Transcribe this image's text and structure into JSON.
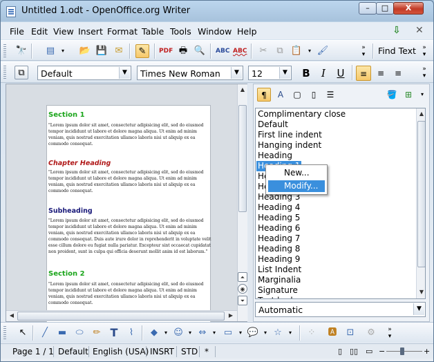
{
  "window": {
    "title": "Untitled 1.odt - OpenOffice.org Writer",
    "min": "–",
    "max": "□",
    "close": "X"
  },
  "menu": [
    "File",
    "Edit",
    "View",
    "Insert",
    "Format",
    "Table",
    "Tools",
    "Window",
    "Help"
  ],
  "toolbar": {
    "find_label": "Find Text"
  },
  "format": {
    "style": "Default",
    "font": "Times New Roman",
    "size": "12",
    "bold": "B",
    "italic": "I",
    "underline": "U"
  },
  "document": {
    "sections": [
      {
        "kind": "section",
        "title": "Section 1",
        "color": "#1aa51a",
        "text": "\"Lorem ipsum dolor sit amet, consectetur adipisicing elit, sed do eiusmod tempor incididunt ut labore et dolore magna aliqua. Ut enim ad minim veniam, quis nostrud exercitation ullamco laboris nisi ut aliquip ex ea commodo consequat."
      },
      {
        "kind": "chapter",
        "title": "Chapter Heading",
        "color": "#b01818",
        "text": "\"Lorem ipsum dolor sit amet, consectetur adipisicing elit, sed do eiusmod tempor incididunt ut labore et dolore magna aliqua. Ut enim ad minim veniam, quis nostrud exercitation ullamco laboris nisi ut aliquip ex ea commodo consequat."
      },
      {
        "kind": "subheading",
        "title": "Subheading",
        "color": "#1a1a7a",
        "text": "\"Lorem ipsum dolor sit amet, consectetur adipisicing elit, sed do eiusmod tempor incididunt ut labore et dolore magna aliqua. Ut enim ad minim veniam, quis nostrud exercitation ullamco laboris nisi ut aliquip ex ea commodo consequat. Duis aute irure dolor in reprehenderit in voluptate velit esse cillum dolore eu fugiat nulla pariatur. Excepteur sint occaecat cupidatat non proident, sunt in culpa qui officia deserunt mollit anim id est laborum.\""
      },
      {
        "kind": "section",
        "title": "Section 2",
        "color": "#1aa51a",
        "text": "\"Lorem ipsum dolor sit amet, consectetur adipisicing elit, sed do eiusmod tempor incididunt ut labore et dolore magna aliqua. Ut enim ad minim veniam, quis nostrud exercitation ullamco laboris nisi ut aliquip ex ea commodo consequat."
      }
    ]
  },
  "stylist": {
    "items": [
      "Complimentary close",
      "Default",
      "First line indent",
      "Hanging indent",
      "Heading",
      "Heading 1",
      "Heading 10",
      "Heading 2",
      "Heading 3",
      "Heading 4",
      "Heading 5",
      "Heading 6",
      "Heading 7",
      "Heading 8",
      "Heading 9",
      "List Indent",
      "Marginalia",
      "Signature",
      "Text body"
    ],
    "selected": "Heading 1",
    "filter": "Automatic"
  },
  "context_menu": {
    "items": [
      "New...",
      "Modify..."
    ],
    "highlighted": "Modify..."
  },
  "status": {
    "page": "Page 1 / 1",
    "style": "Default",
    "language": "English (USA)",
    "insert": "INSRT",
    "select": "STD",
    "modified": "*"
  }
}
